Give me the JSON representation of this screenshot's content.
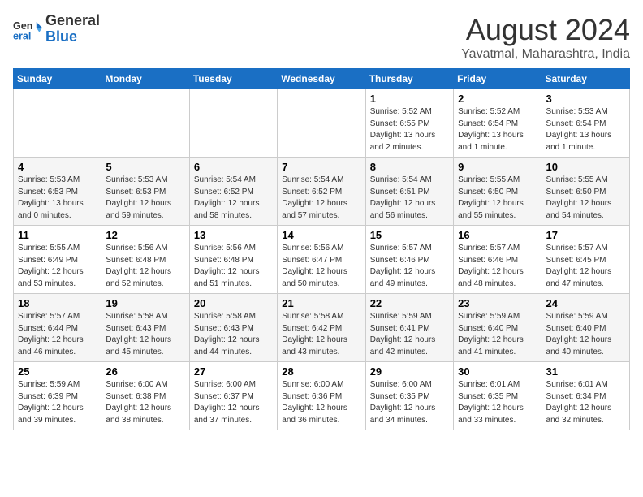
{
  "header": {
    "logo_line1": "General",
    "logo_line2": "Blue",
    "month": "August 2024",
    "location": "Yavatmal, Maharashtra, India"
  },
  "weekdays": [
    "Sunday",
    "Monday",
    "Tuesday",
    "Wednesday",
    "Thursday",
    "Friday",
    "Saturday"
  ],
  "weeks": [
    [
      {
        "day": "",
        "info": ""
      },
      {
        "day": "",
        "info": ""
      },
      {
        "day": "",
        "info": ""
      },
      {
        "day": "",
        "info": ""
      },
      {
        "day": "1",
        "info": "Sunrise: 5:52 AM\nSunset: 6:55 PM\nDaylight: 13 hours\nand 2 minutes."
      },
      {
        "day": "2",
        "info": "Sunrise: 5:52 AM\nSunset: 6:54 PM\nDaylight: 13 hours\nand 1 minute."
      },
      {
        "day": "3",
        "info": "Sunrise: 5:53 AM\nSunset: 6:54 PM\nDaylight: 13 hours\nand 1 minute."
      }
    ],
    [
      {
        "day": "4",
        "info": "Sunrise: 5:53 AM\nSunset: 6:53 PM\nDaylight: 13 hours\nand 0 minutes."
      },
      {
        "day": "5",
        "info": "Sunrise: 5:53 AM\nSunset: 6:53 PM\nDaylight: 12 hours\nand 59 minutes."
      },
      {
        "day": "6",
        "info": "Sunrise: 5:54 AM\nSunset: 6:52 PM\nDaylight: 12 hours\nand 58 minutes."
      },
      {
        "day": "7",
        "info": "Sunrise: 5:54 AM\nSunset: 6:52 PM\nDaylight: 12 hours\nand 57 minutes."
      },
      {
        "day": "8",
        "info": "Sunrise: 5:54 AM\nSunset: 6:51 PM\nDaylight: 12 hours\nand 56 minutes."
      },
      {
        "day": "9",
        "info": "Sunrise: 5:55 AM\nSunset: 6:50 PM\nDaylight: 12 hours\nand 55 minutes."
      },
      {
        "day": "10",
        "info": "Sunrise: 5:55 AM\nSunset: 6:50 PM\nDaylight: 12 hours\nand 54 minutes."
      }
    ],
    [
      {
        "day": "11",
        "info": "Sunrise: 5:55 AM\nSunset: 6:49 PM\nDaylight: 12 hours\nand 53 minutes."
      },
      {
        "day": "12",
        "info": "Sunrise: 5:56 AM\nSunset: 6:48 PM\nDaylight: 12 hours\nand 52 minutes."
      },
      {
        "day": "13",
        "info": "Sunrise: 5:56 AM\nSunset: 6:48 PM\nDaylight: 12 hours\nand 51 minutes."
      },
      {
        "day": "14",
        "info": "Sunrise: 5:56 AM\nSunset: 6:47 PM\nDaylight: 12 hours\nand 50 minutes."
      },
      {
        "day": "15",
        "info": "Sunrise: 5:57 AM\nSunset: 6:46 PM\nDaylight: 12 hours\nand 49 minutes."
      },
      {
        "day": "16",
        "info": "Sunrise: 5:57 AM\nSunset: 6:46 PM\nDaylight: 12 hours\nand 48 minutes."
      },
      {
        "day": "17",
        "info": "Sunrise: 5:57 AM\nSunset: 6:45 PM\nDaylight: 12 hours\nand 47 minutes."
      }
    ],
    [
      {
        "day": "18",
        "info": "Sunrise: 5:57 AM\nSunset: 6:44 PM\nDaylight: 12 hours\nand 46 minutes."
      },
      {
        "day": "19",
        "info": "Sunrise: 5:58 AM\nSunset: 6:43 PM\nDaylight: 12 hours\nand 45 minutes."
      },
      {
        "day": "20",
        "info": "Sunrise: 5:58 AM\nSunset: 6:43 PM\nDaylight: 12 hours\nand 44 minutes."
      },
      {
        "day": "21",
        "info": "Sunrise: 5:58 AM\nSunset: 6:42 PM\nDaylight: 12 hours\nand 43 minutes."
      },
      {
        "day": "22",
        "info": "Sunrise: 5:59 AM\nSunset: 6:41 PM\nDaylight: 12 hours\nand 42 minutes."
      },
      {
        "day": "23",
        "info": "Sunrise: 5:59 AM\nSunset: 6:40 PM\nDaylight: 12 hours\nand 41 minutes."
      },
      {
        "day": "24",
        "info": "Sunrise: 5:59 AM\nSunset: 6:40 PM\nDaylight: 12 hours\nand 40 minutes."
      }
    ],
    [
      {
        "day": "25",
        "info": "Sunrise: 5:59 AM\nSunset: 6:39 PM\nDaylight: 12 hours\nand 39 minutes."
      },
      {
        "day": "26",
        "info": "Sunrise: 6:00 AM\nSunset: 6:38 PM\nDaylight: 12 hours\nand 38 minutes."
      },
      {
        "day": "27",
        "info": "Sunrise: 6:00 AM\nSunset: 6:37 PM\nDaylight: 12 hours\nand 37 minutes."
      },
      {
        "day": "28",
        "info": "Sunrise: 6:00 AM\nSunset: 6:36 PM\nDaylight: 12 hours\nand 36 minutes."
      },
      {
        "day": "29",
        "info": "Sunrise: 6:00 AM\nSunset: 6:35 PM\nDaylight: 12 hours\nand 34 minutes."
      },
      {
        "day": "30",
        "info": "Sunrise: 6:01 AM\nSunset: 6:35 PM\nDaylight: 12 hours\nand 33 minutes."
      },
      {
        "day": "31",
        "info": "Sunrise: 6:01 AM\nSunset: 6:34 PM\nDaylight: 12 hours\nand 32 minutes."
      }
    ]
  ]
}
